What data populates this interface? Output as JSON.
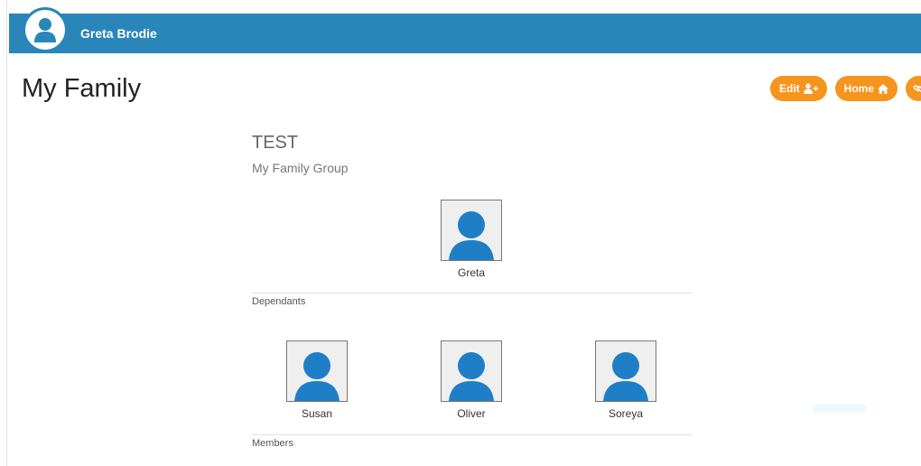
{
  "topbar": {
    "user_name": "Greta Brodie",
    "color": "#2a86b8",
    "avatar_icon": "user-icon"
  },
  "page": {
    "title": "My Family"
  },
  "actions": [
    {
      "label": "Edit",
      "icon": "user-plus-icon"
    },
    {
      "label": "Home",
      "icon": "home-icon"
    },
    {
      "label": "",
      "icon": "link-icon"
    }
  ],
  "accent": "#f7941d",
  "group": {
    "name": "TEST",
    "subtitle": "My Family Group"
  },
  "primary_member": {
    "name": "Greta"
  },
  "sections": {
    "dependants": "Dependants",
    "members": "Members"
  },
  "dependants": [
    {
      "name": "Susan"
    },
    {
      "name": "Oliver"
    },
    {
      "name": "Soreya"
    }
  ]
}
